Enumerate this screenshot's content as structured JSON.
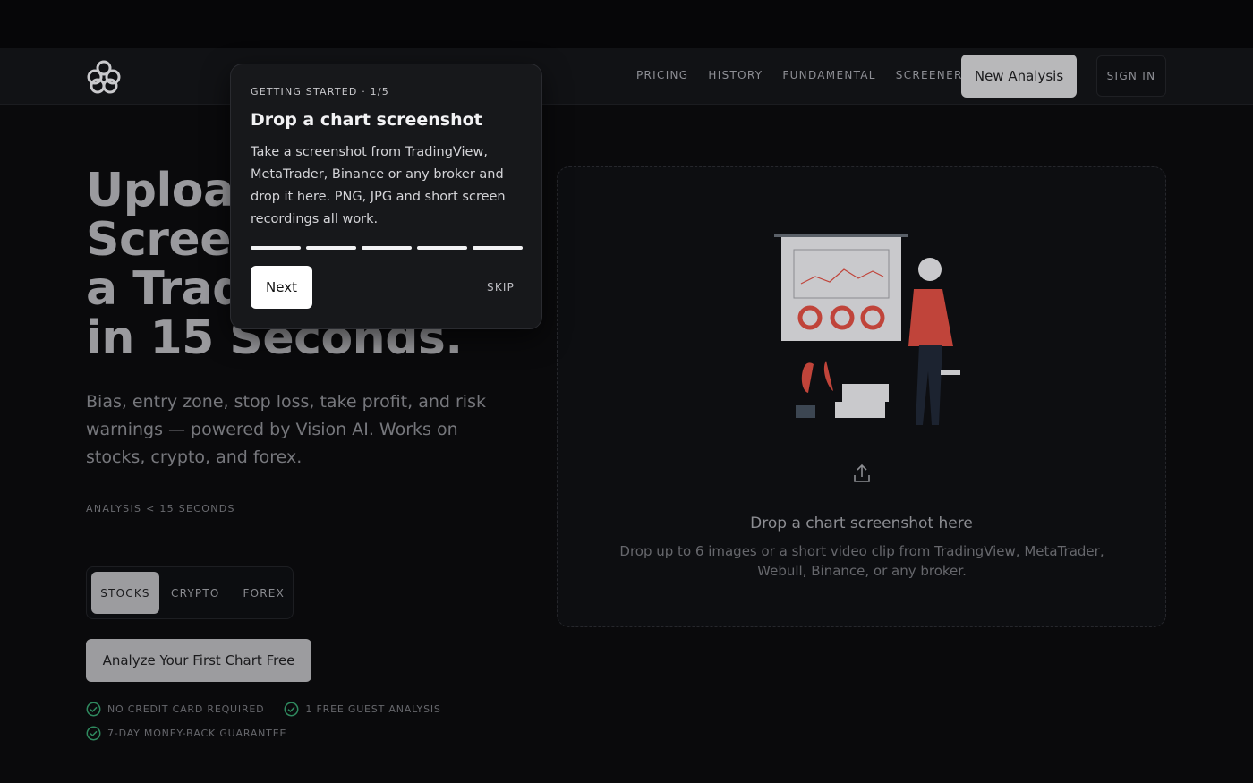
{
  "nav": {
    "links": [
      "PRICING",
      "HISTORY",
      "FUNDAMENTAL",
      "SCREENER"
    ],
    "new_analysis": "New Analysis",
    "sign_in": "SIGN IN"
  },
  "hero": {
    "title_lines": [
      "Upload a Chart",
      "Screenshot, Get",
      "a Trade Plan",
      "in 15 Seconds."
    ],
    "subtitle": "Bias, entry zone, stop loss, take profit, and risk warnings — powered by Vision AI. Works on stocks, crypto, and forex.",
    "meta": "ANALYSIS < 15 SECONDS",
    "markets": [
      "STOCKS",
      "CRYPTO",
      "FOREX"
    ],
    "active_market": "STOCKS",
    "cta": "Analyze Your First Chart Free",
    "checks": [
      "NO CREDIT CARD REQUIRED",
      "1 FREE GUEST ANALYSIS",
      "7-DAY MONEY-BACK GUARANTEE"
    ]
  },
  "dropzone": {
    "title": "Drop a chart screenshot here",
    "subtitle": "Drop up to 6 images or a short video clip from TradingView, MetaTrader, Webull, Binance, or any broker."
  },
  "tour": {
    "step": "GETTING STARTED · 1/5",
    "title": "Drop a chart screenshot",
    "body": "Take a screenshot from TradingView, MetaTrader, Binance or any broker and drop it here. PNG, JPG and short screen recordings all work.",
    "next": "Next",
    "skip": "SKIP",
    "progress_segments": 5
  },
  "colors": {
    "accent_red": "#c0443a",
    "check_green": "#2f8a5f"
  }
}
